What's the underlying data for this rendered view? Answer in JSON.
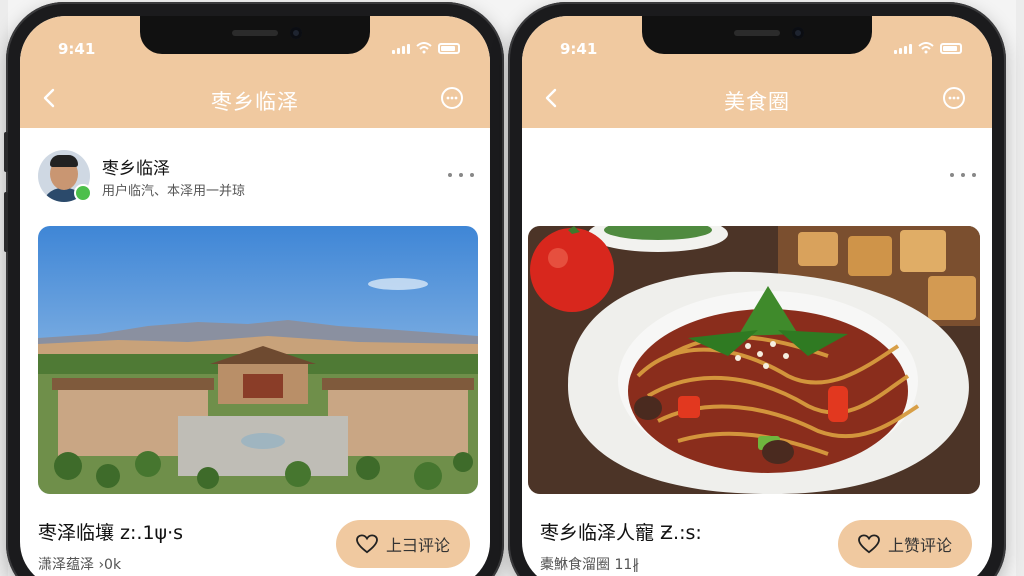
{
  "status_bar": {
    "time": "9:41"
  },
  "phones": [
    {
      "header": {
        "title": "枣乡临泽"
      },
      "post": {
        "author_name": "枣乡临泽",
        "author_subtitle": "用户临汽、本泽用一并琼",
        "photo_subject": "landscape-architecture",
        "caption": "枣泽临壤 z:.1ψ·s",
        "meta": "潇泽蕴泽 ›0k",
        "comment_button_label": "上彐评论"
      }
    },
    {
      "header": {
        "title": "美食圈"
      },
      "post": {
        "photo_subject": "noodle-dish",
        "caption": "枣乡临泽人寵 Ƶ.:s:",
        "meta": "橐鮴食溜圈 11∦",
        "comment_button_label": "上赞评论"
      }
    }
  ],
  "colors": {
    "header_bg": "#f0c9a0",
    "button_bg": "#f0c9a0",
    "phone_frame": "#1b1b1d"
  },
  "icons": [
    "back-chevron-icon",
    "more-circle-icon",
    "ellipsis-icon",
    "heart-icon",
    "wechat-badge-icon",
    "signal-icon",
    "wifi-icon",
    "battery-icon"
  ]
}
